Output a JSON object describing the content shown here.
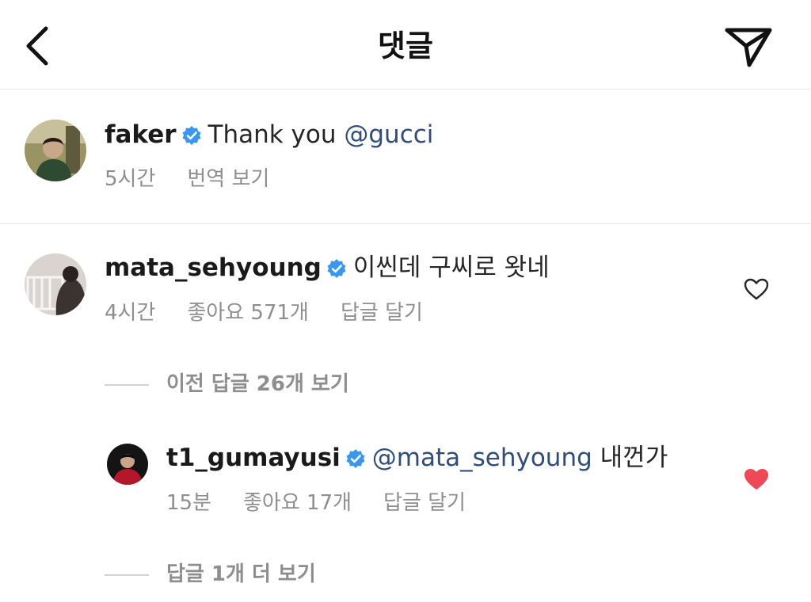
{
  "header": {
    "title": "댓글",
    "back_icon": "chevron-left-icon",
    "share_icon": "send-icon"
  },
  "caption": {
    "username": "faker",
    "verified": true,
    "text": "Thank you ",
    "mention": "@gucci",
    "time": "5시간",
    "translate_label": "번역 보기"
  },
  "comment": {
    "username": "mata_sehyoung",
    "verified": true,
    "text": "이씬데 구씨로 왓네",
    "time": "4시간",
    "likes": "좋아요 571개",
    "reply_label": "답글 달기",
    "liked": false,
    "view_previous_replies": "이전 답글 26개 보기"
  },
  "reply": {
    "username": "t1_gumayusi",
    "verified": true,
    "mention": "@mata_sehyoung",
    "text": " 내껀가",
    "time": "15분",
    "likes": "좋아요 17개",
    "reply_label": "답글 달기",
    "liked": true,
    "view_more_replies": "답글 1개 더 보기"
  },
  "colors": {
    "verified_blue": "#3897f0",
    "mention_blue": "#2f4d78",
    "heart_red": "#ed4956",
    "meta_gray": "#8e8e8e"
  }
}
